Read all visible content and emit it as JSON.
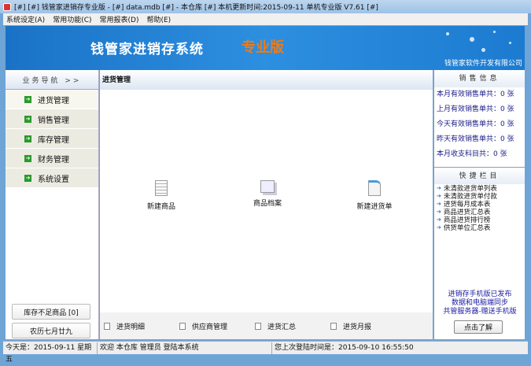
{
  "title": "[#] [#] 钱管家进销存专业版 - [#] data.mdb [#] - 本仓库 [#] 本机更新时间:2015-09-11 单机专业版 V7.61 [#]",
  "menu": [
    "系统设定(A)",
    "常用功能(C)",
    "常用报表(D)",
    "帮助(E)"
  ],
  "banner": {
    "title": "钱管家进销存系统",
    "edition": "专业版",
    "company": "钱管家软件开发有限公司"
  },
  "nav": {
    "header": "业务导航 >>",
    "items": [
      "进货管理",
      "销售管理",
      "库存管理",
      "财务管理",
      "系统设置"
    ],
    "low_stock": "库存不足商品 [0]",
    "lunar": "农历七月廿九"
  },
  "main": {
    "title": "进货管理",
    "icons": [
      "新建商品",
      "商品档案",
      "新建进货单"
    ],
    "bottom": [
      "进货明细",
      "供应商管理",
      "进货汇总",
      "进货月报"
    ]
  },
  "sales": {
    "title": "销售信息",
    "stats": [
      "本月有效销售单共：0 张",
      "上月有效销售单共：0 张",
      "今天有效销售单共：0 张",
      "昨天有效销售单共：0 张",
      "本月收支科目共：0 张"
    ]
  },
  "quick": {
    "title": "快捷栏目",
    "links": [
      "未清款进货单列表",
      "未清款进货单付款",
      "进货每月成本表",
      "商品进货汇总表",
      "商品进货排行榜",
      "供货单位汇总表"
    ]
  },
  "promo": {
    "lines": [
      "进销存手机版已发布",
      "数据和电脑端同步",
      "共管服务器-赠送手机版"
    ],
    "button": "点击了解"
  },
  "status": {
    "date": "今天是：2015-09-11 星期五",
    "welcome": "欢迎 本仓库 管理员 登陆本系统",
    "last": "您上次登陆时间是：2015-09-10 16:55:50"
  }
}
